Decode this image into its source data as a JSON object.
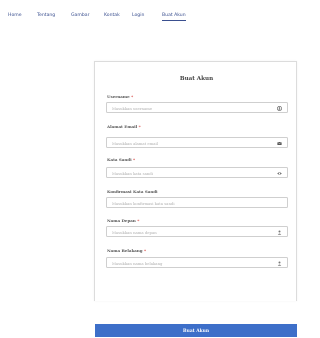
{
  "nav": {
    "items": [
      {
        "label": "Home"
      },
      {
        "label": "Tentang"
      },
      {
        "label": "Gambar"
      },
      {
        "label": "Kontak"
      },
      {
        "label": "Login"
      },
      {
        "label": "Buat Akun"
      }
    ],
    "active": "Buat Akun"
  },
  "form": {
    "title": "Buat Akun",
    "required_mark": "*",
    "fields": [
      {
        "label": "Username",
        "required": true,
        "placeholder": "Masukkan username",
        "icon": "user-circle-icon"
      },
      {
        "label": "Alamat Email",
        "required": true,
        "placeholder": "Masukkan alamat email",
        "icon": "envelope-icon"
      },
      {
        "label": "Kata Sandi",
        "required": true,
        "placeholder": "Masukkan kata sandi",
        "icon": "eye-icon"
      },
      {
        "label": "Konfirmasi Kata Sandi",
        "required": false,
        "placeholder": "Masukkan konfirmasi kata sandi",
        "icon": ""
      },
      {
        "label": "Nama Depan",
        "required": true,
        "placeholder": "Masukkan nama depan",
        "icon": "person-icon"
      },
      {
        "label": "Nama Belakang",
        "required": true,
        "placeholder": "Masukkan nama belakang",
        "icon": "person-icon"
      }
    ],
    "submit_label": "Buat Akun"
  },
  "colors": {
    "accent": "#3d6fc9",
    "nav_link": "#3a4f8f",
    "required": "#d9534f"
  }
}
